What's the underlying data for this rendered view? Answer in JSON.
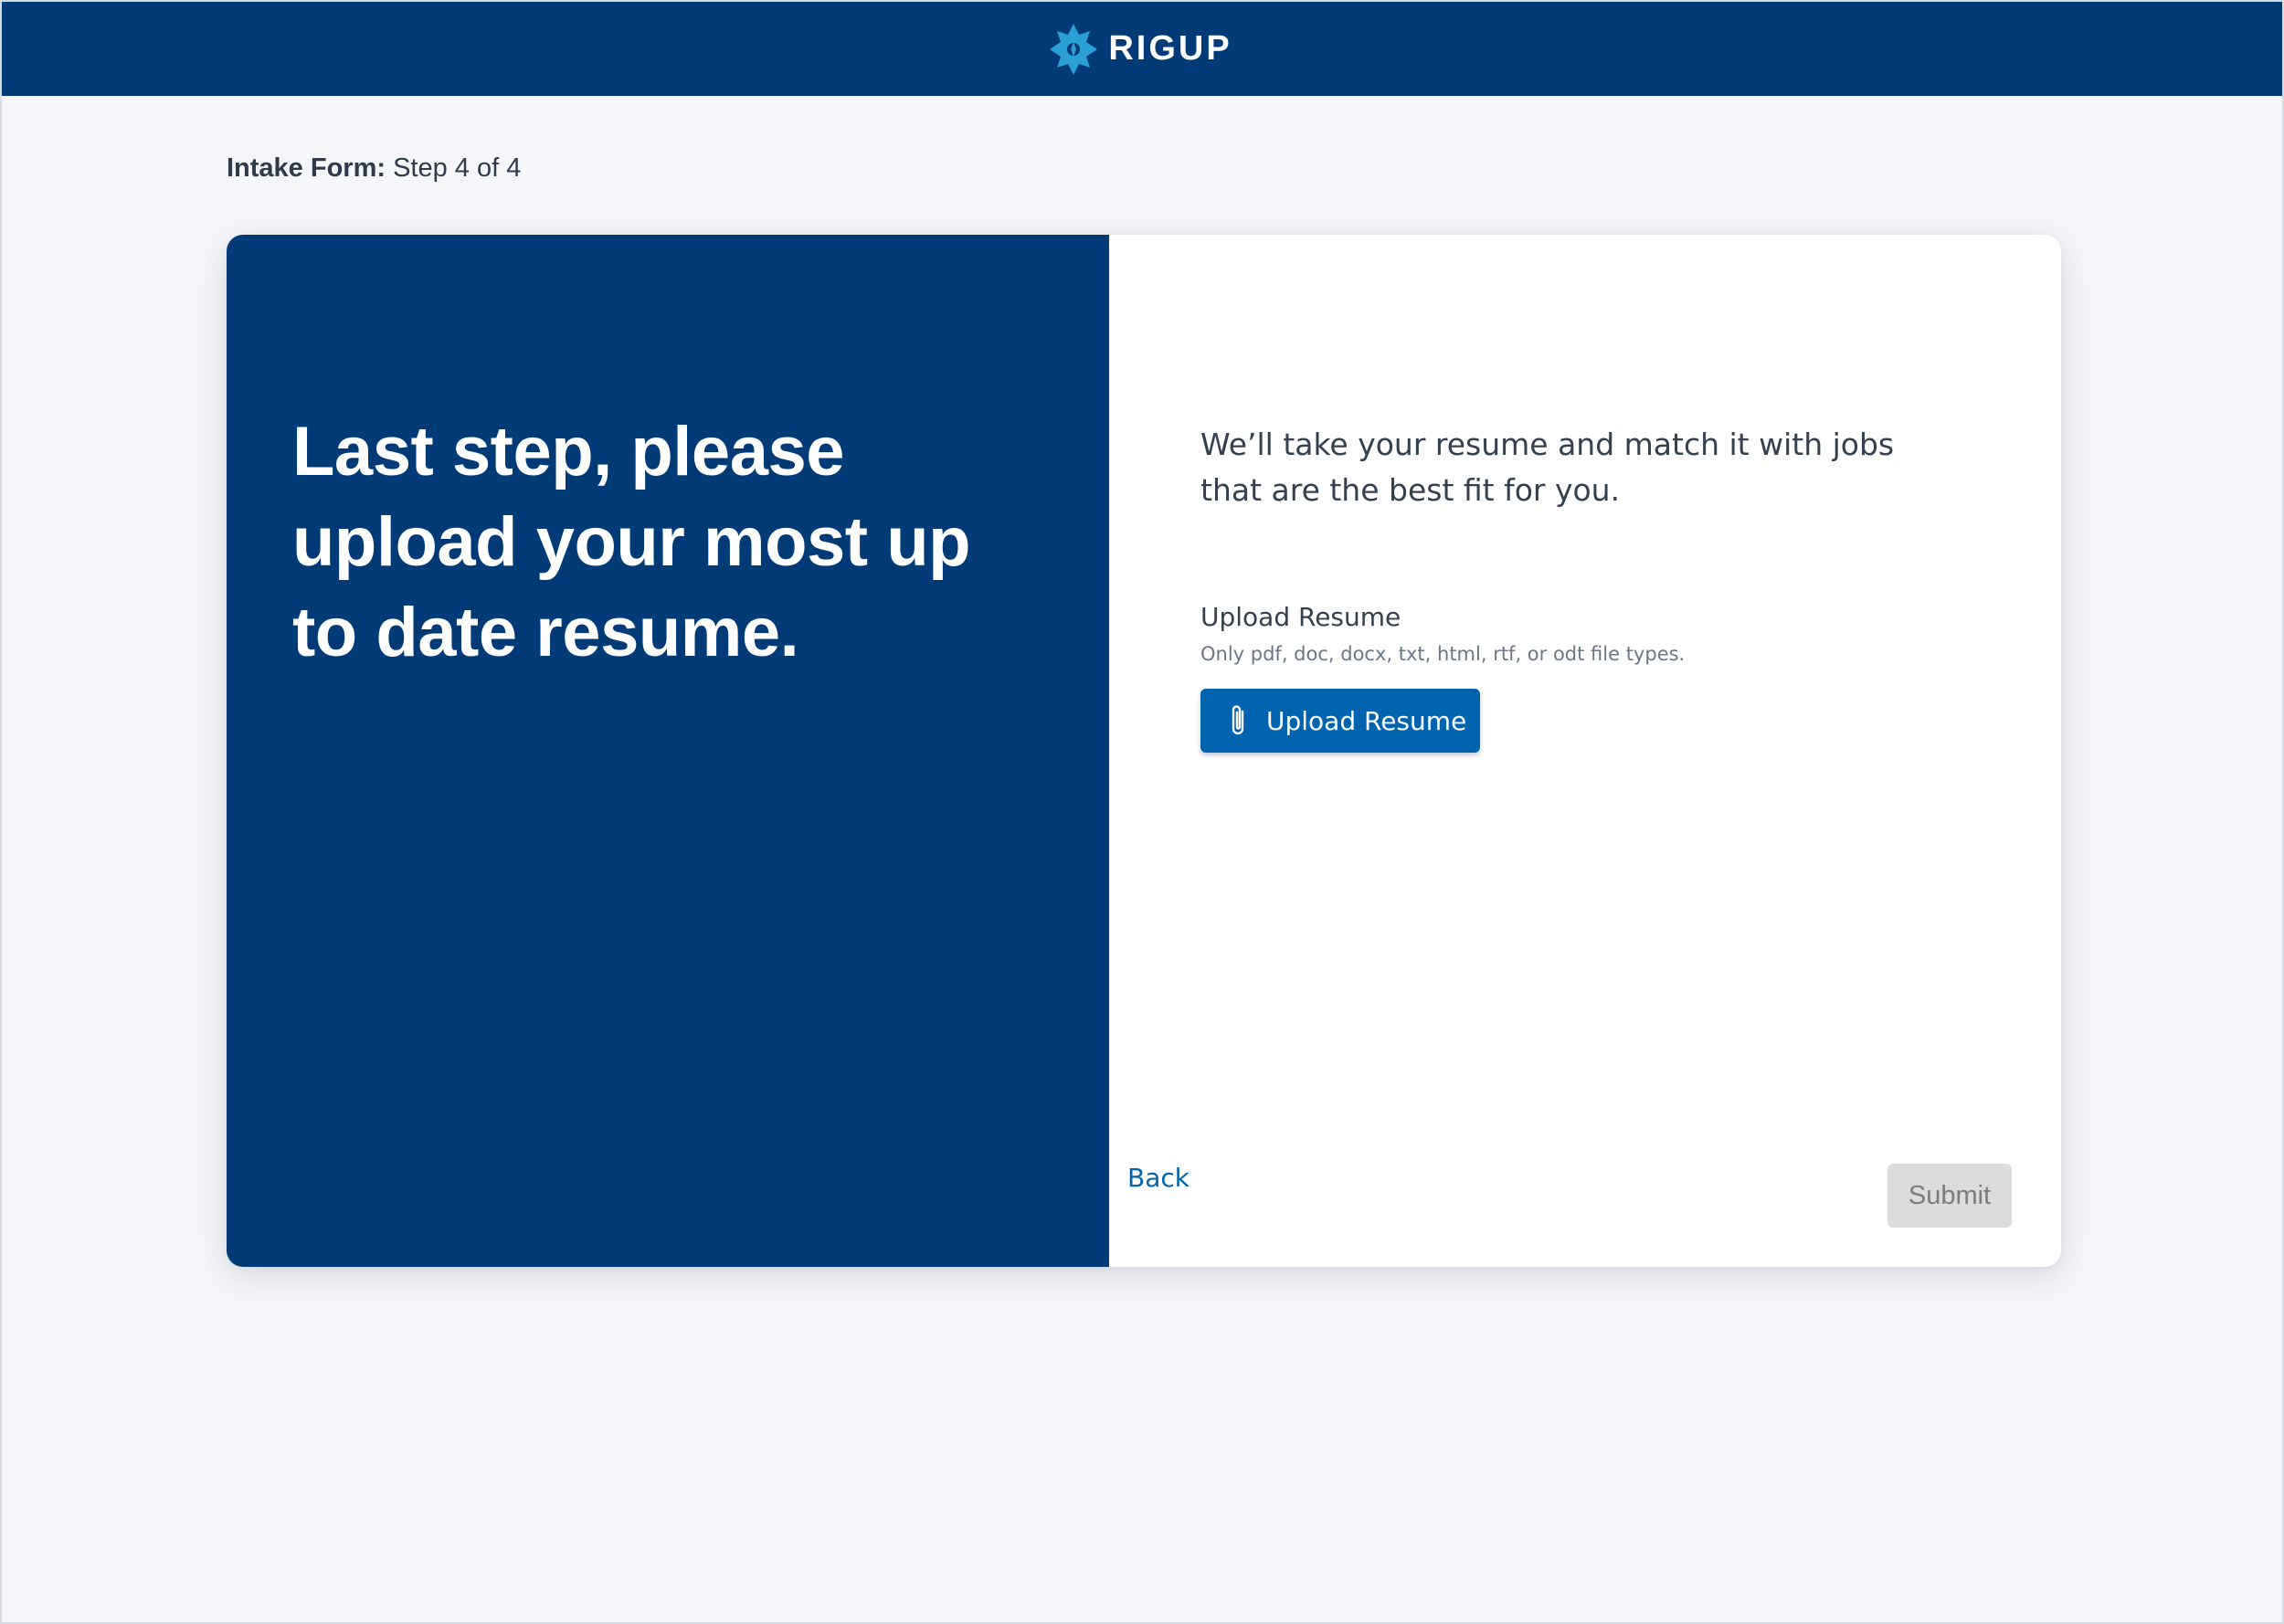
{
  "header": {
    "brand_name": "RIGUP",
    "logo_icon": "gear-star-logo",
    "background_color": "#003b78",
    "logo_color": "#2ba0d4"
  },
  "progress": {
    "label": "Intake Form:",
    "step_text": "Step 4 of 4",
    "current_step": 4,
    "total_steps": 4
  },
  "left_panel": {
    "headline": "Last step, please upload your most up to date resume.",
    "background_color": "#003b78"
  },
  "right_panel": {
    "intro": "We’ll take your resume and match it with jobs that are the best fit for you.",
    "upload": {
      "label": "Upload Resume",
      "hint": "Only pdf, doc, docx, txt, html, rtf, or odt file types.",
      "button_label": "Upload Resume",
      "button_icon": "paperclip-icon",
      "button_color": "#0063b0"
    }
  },
  "actions": {
    "back_label": "Back",
    "submit_label": "Submit",
    "submit_disabled": true
  }
}
